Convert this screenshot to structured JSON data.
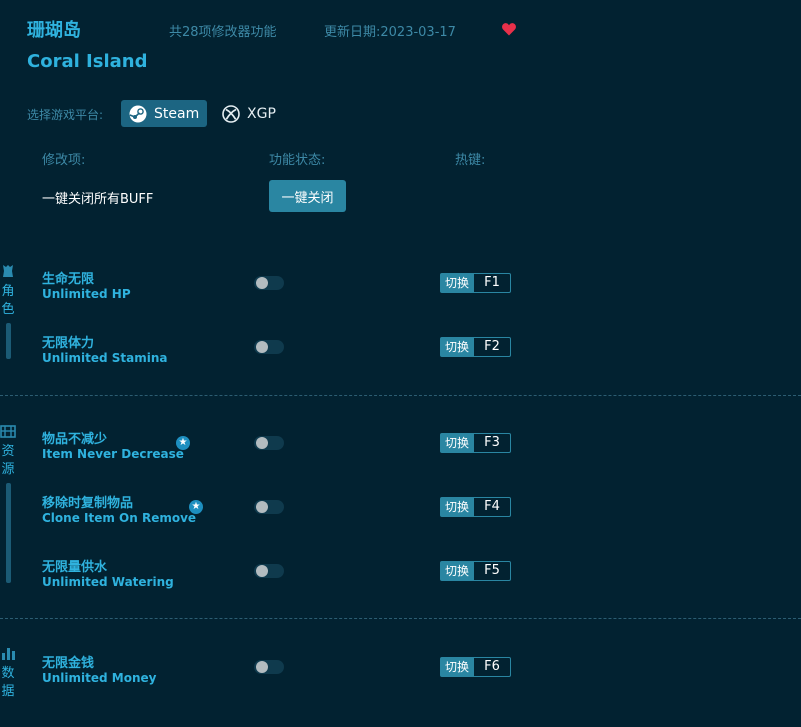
{
  "header": {
    "title_cn": "珊瑚岛",
    "title_en": "Coral Island",
    "feature_count": "共28项修改器功能",
    "update_date": "更新日期:2023-03-17",
    "favorite_icon": "heart-icon"
  },
  "platform": {
    "label": "选择游戏平台:",
    "options": [
      {
        "label": "Steam",
        "icon": "steam-icon",
        "selected": true
      },
      {
        "label": "XGP",
        "icon": "xbox-icon",
        "selected": false
      }
    ]
  },
  "columns": {
    "item": "修改项:",
    "status": "功能状态:",
    "hotkey": "热键:"
  },
  "close_all": {
    "label": "一键关闭所有BUFF",
    "button": "一键关闭"
  },
  "categories": [
    {
      "name": "角色",
      "icon": "character-icon"
    },
    {
      "name": "资源",
      "icon": "resources-icon"
    },
    {
      "name": "数据",
      "icon": "data-icon"
    }
  ],
  "features": [
    {
      "cn": "生命无限",
      "en": "Unlimited HP",
      "action": "切换",
      "key": "F1",
      "starred": false,
      "enabled": false
    },
    {
      "cn": "无限体力",
      "en": "Unlimited Stamina",
      "action": "切换",
      "key": "F2",
      "starred": false,
      "enabled": false
    },
    {
      "cn": "物品不减少",
      "en": "Item Never Decrease",
      "action": "切换",
      "key": "F3",
      "starred": true,
      "enabled": false
    },
    {
      "cn": "移除时复制物品",
      "en": "Clone Item On Remove",
      "action": "切换",
      "key": "F4",
      "starred": true,
      "enabled": false
    },
    {
      "cn": "无限量供水",
      "en": "Unlimited Watering",
      "action": "切换",
      "key": "F5",
      "starred": false,
      "enabled": false
    },
    {
      "cn": "无限金钱",
      "en": "Unlimited Money",
      "action": "切换",
      "key": "F6",
      "starred": false,
      "enabled": false
    }
  ],
  "colors": {
    "background": "#022231",
    "accent": "#2fb2de",
    "button": "#2a86a2",
    "heart": "#e8304a"
  }
}
